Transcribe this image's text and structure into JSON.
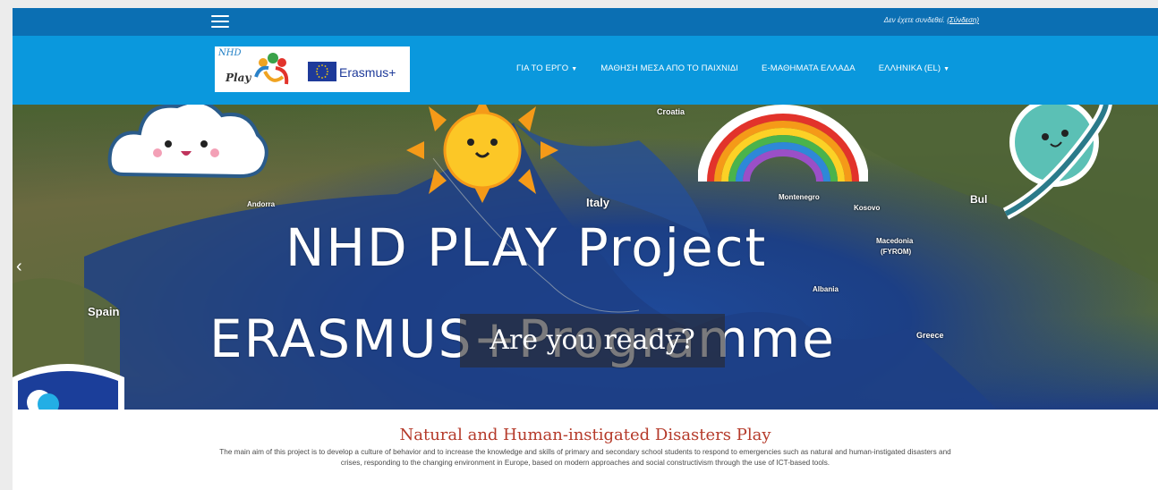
{
  "topbar": {
    "login_text": "Δεν έχετε συνδεθεί.",
    "login_link": "(Σύνδεση)"
  },
  "logo": {
    "nhd": "NHD",
    "play": "Play",
    "erasmus": "Erasmus+"
  },
  "nav": [
    {
      "label": "ΓΙΑ ΤΟ ΕΡΓΟ",
      "dropdown": true
    },
    {
      "label": "ΜΑΘΗΣΗ ΜΕΣΑ ΑΠΟ ΤΟ ΠΑΙΧΝΙΔΙ",
      "dropdown": false
    },
    {
      "label": "Ε-ΜΑΘΗΜΑΤΑ ΕΛΛΑΔΑ",
      "dropdown": false
    },
    {
      "label": "ΕΛΛΗΝΙΚΑ (EL)",
      "dropdown": true
    }
  ],
  "hero": {
    "title": "NHD PLAY Project",
    "subtitle": "ERASMUS+Programme",
    "ready": "Are you ready?",
    "map_labels": {
      "croatia": "Croatia",
      "italy": "Italy",
      "andorra": "Andorra",
      "spain": "Spain",
      "montenegro": "Montenegro",
      "kosovo": "Kosovo",
      "macedonia": "Macedonia",
      "fyrom": "(FYROM)",
      "albania": "Albania",
      "greece": "Greece",
      "bul": "Bul"
    }
  },
  "content": {
    "title": "Natural and Human-instigated Disasters Play",
    "body": "The main aim of this project is to develop a culture of behavior and to increase the knowledge and skills of primary and secondary school students to respond to emergencies such as natural and human-instigated disasters and crises, responding to the changing environment in Europe, based on modern approaches and social constructivism through the use of ICT-based tools."
  },
  "colors": {
    "topbar": "#0b6fb3",
    "header": "#0a98dd",
    "title_accent": "#b53a2a"
  }
}
